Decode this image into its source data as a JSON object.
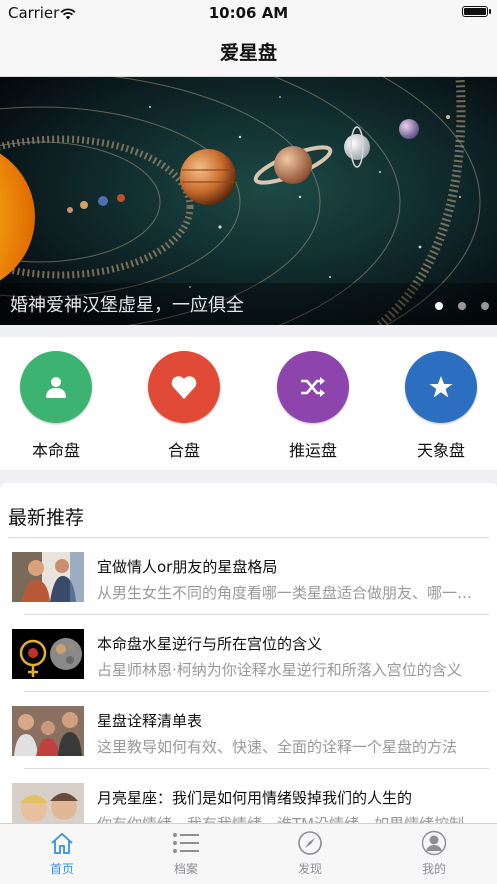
{
  "status_bar": {
    "carrier": "Carrier",
    "time": "10:06 AM"
  },
  "nav": {
    "title": "爱星盘"
  },
  "banner": {
    "caption": "婚神爱神汉堡虚星，一应俱全",
    "page_count": 3,
    "active_page": 1
  },
  "categories": [
    {
      "label": "本命盘",
      "icon": "person-icon",
      "color": "#3cb371"
    },
    {
      "label": "合盘",
      "icon": "heart-icon",
      "color": "#e04a36"
    },
    {
      "label": "推运盘",
      "icon": "shuffle-icon",
      "color": "#8e44ad"
    },
    {
      "label": "天象盘",
      "icon": "star-icon",
      "color": "#2c6fc0"
    }
  ],
  "recommend": {
    "title": "最新推荐",
    "items": [
      {
        "title": "宜做情人or朋友的星盘格局",
        "subtitle": "从男生女生不同的角度看哪一类星盘适合做朋友、哪一类适合做情人"
      },
      {
        "title": "本命盘水星逆行与所在宫位的含义",
        "subtitle": "占星师林恩·柯纳为你诠释水星逆行和所落入宫位的含义"
      },
      {
        "title": "星盘诠释清单表",
        "subtitle": "这里教导如何有效、快速、全面的诠释一个星盘的方法"
      },
      {
        "title": "月亮星座：我们是如何用情绪毁掉我们的人生的",
        "subtitle": "你有你情绪，我有我情绪，谁TM没情绪，如果情绪控制不好"
      }
    ]
  },
  "tabbar": [
    {
      "label": "首页",
      "icon": "home-icon",
      "active": true
    },
    {
      "label": "档案",
      "icon": "list-icon",
      "active": false
    },
    {
      "label": "发现",
      "icon": "compass-icon",
      "active": false
    },
    {
      "label": "我的",
      "icon": "profile-icon",
      "active": false
    }
  ],
  "colors": {
    "accent": "#3b8fe0",
    "inactive": "#8e8e93"
  }
}
